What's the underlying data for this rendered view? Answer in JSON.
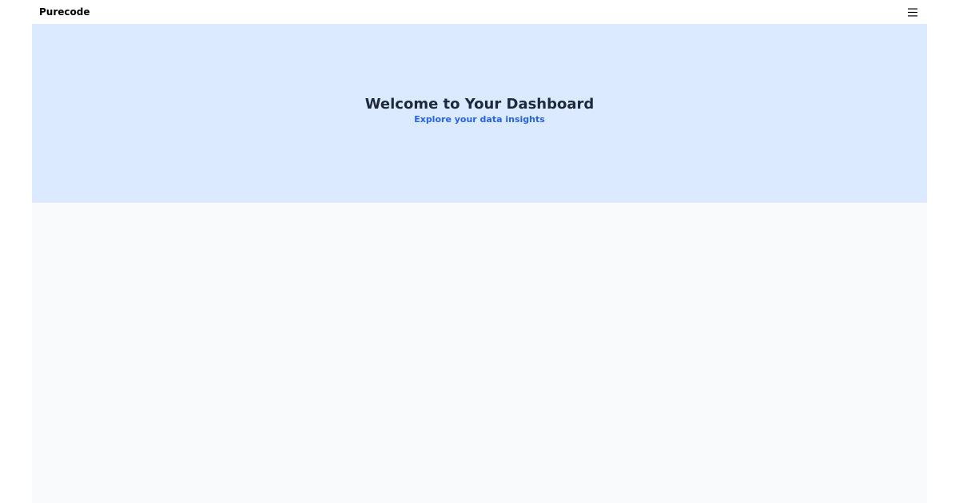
{
  "navbar": {
    "brand": "Purecode",
    "menu_icon": "hamburger-menu-icon"
  },
  "hero": {
    "title": "Welcome to Your Dashboard",
    "subtitle": "Explore your data insights"
  },
  "colors": {
    "hero_background": "#dbeafe",
    "page_background": "#f8fafc",
    "title_color": "#1e293b",
    "accent": "#2563eb"
  }
}
